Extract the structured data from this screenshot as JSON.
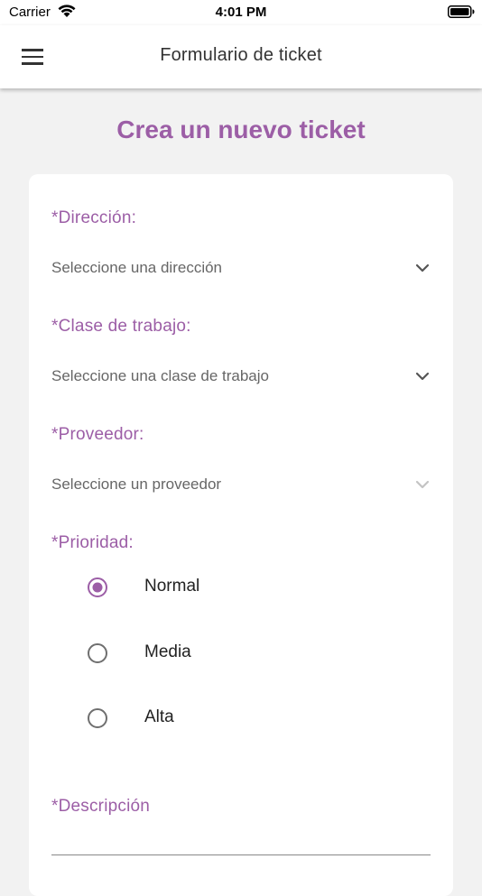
{
  "status_bar": {
    "carrier": "Carrier",
    "time": "4:01 PM"
  },
  "app_bar": {
    "title": "Formulario de ticket"
  },
  "page": {
    "heading": "Crea un nuevo ticket"
  },
  "form": {
    "direccion": {
      "label": "*Dirección:",
      "placeholder": "Seleccione una dirección"
    },
    "clase_trabajo": {
      "label": "*Clase de trabajo:",
      "placeholder": "Seleccione una clase de trabajo"
    },
    "proveedor": {
      "label": "*Proveedor:",
      "placeholder": "Seleccione un proveedor"
    },
    "prioridad": {
      "label": "*Prioridad:",
      "options": [
        {
          "label": "Normal",
          "selected": true
        },
        {
          "label": "Media",
          "selected": false
        },
        {
          "label": "Alta",
          "selected": false
        }
      ]
    },
    "descripcion": {
      "label": "*Descripción"
    }
  },
  "colors": {
    "accent": "#9c5ea6",
    "background": "#f2f2f2",
    "card": "#ffffff"
  },
  "icons": {
    "menu": "hamburger-menu-icon",
    "dropdown": "chevron-down-icon",
    "wifi": "wifi-icon",
    "battery": "battery-icon"
  }
}
